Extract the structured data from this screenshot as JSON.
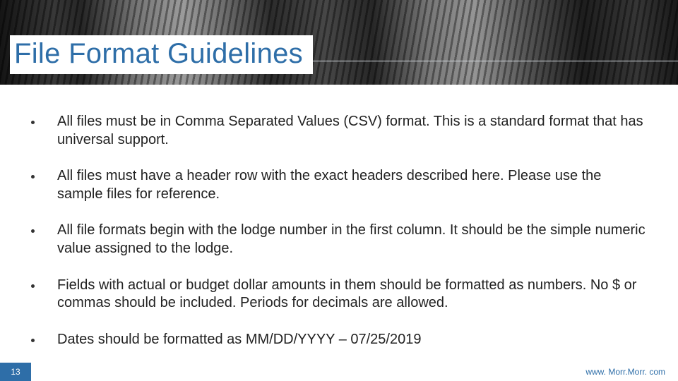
{
  "title": "File Format Guidelines",
  "bullets": [
    "All files must be in Comma Separated Values (CSV) format.  This is a standard format that has universal support.",
    "All files must have a header row with the exact headers described here. Please use the sample files for reference.",
    "All file formats begin with the lodge number in the first column. It should be the simple numeric value assigned to the lodge.",
    "Fields with actual or budget dollar amounts in them should be formatted as numbers. No $ or commas should be included. Periods for decimals are allowed.",
    "Dates should be formatted as MM/DD/YYYY – 07/25/2019"
  ],
  "page_number": "13",
  "footer_url": "www. Morr.Morr. com"
}
